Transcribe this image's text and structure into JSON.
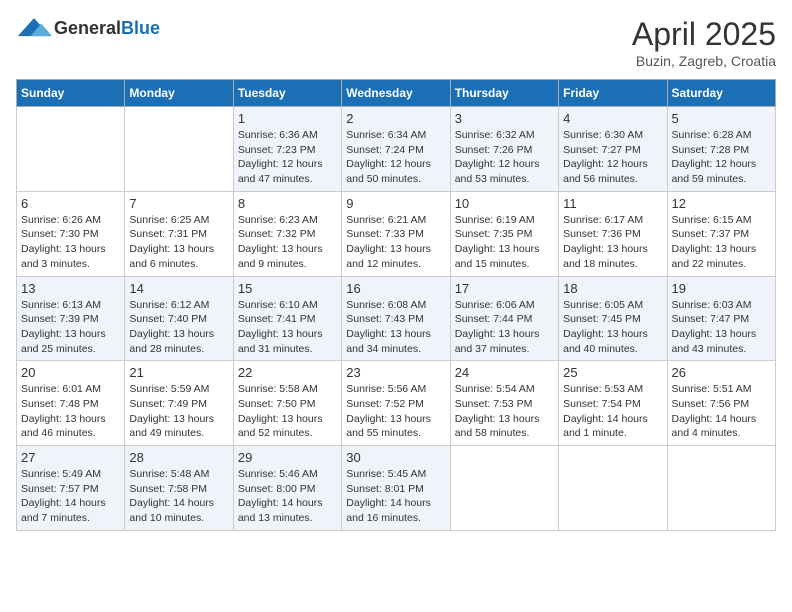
{
  "header": {
    "logo_general": "General",
    "logo_blue": "Blue",
    "month": "April 2025",
    "location": "Buzin, Zagreb, Croatia"
  },
  "weekdays": [
    "Sunday",
    "Monday",
    "Tuesday",
    "Wednesday",
    "Thursday",
    "Friday",
    "Saturday"
  ],
  "weeks": [
    [
      {
        "day": "",
        "sunrise": "",
        "sunset": "",
        "daylight": ""
      },
      {
        "day": "",
        "sunrise": "",
        "sunset": "",
        "daylight": ""
      },
      {
        "day": "1",
        "sunrise": "Sunrise: 6:36 AM",
        "sunset": "Sunset: 7:23 PM",
        "daylight": "Daylight: 12 hours and 47 minutes."
      },
      {
        "day": "2",
        "sunrise": "Sunrise: 6:34 AM",
        "sunset": "Sunset: 7:24 PM",
        "daylight": "Daylight: 12 hours and 50 minutes."
      },
      {
        "day": "3",
        "sunrise": "Sunrise: 6:32 AM",
        "sunset": "Sunset: 7:26 PM",
        "daylight": "Daylight: 12 hours and 53 minutes."
      },
      {
        "day": "4",
        "sunrise": "Sunrise: 6:30 AM",
        "sunset": "Sunset: 7:27 PM",
        "daylight": "Daylight: 12 hours and 56 minutes."
      },
      {
        "day": "5",
        "sunrise": "Sunrise: 6:28 AM",
        "sunset": "Sunset: 7:28 PM",
        "daylight": "Daylight: 12 hours and 59 minutes."
      }
    ],
    [
      {
        "day": "6",
        "sunrise": "Sunrise: 6:26 AM",
        "sunset": "Sunset: 7:30 PM",
        "daylight": "Daylight: 13 hours and 3 minutes."
      },
      {
        "day": "7",
        "sunrise": "Sunrise: 6:25 AM",
        "sunset": "Sunset: 7:31 PM",
        "daylight": "Daylight: 13 hours and 6 minutes."
      },
      {
        "day": "8",
        "sunrise": "Sunrise: 6:23 AM",
        "sunset": "Sunset: 7:32 PM",
        "daylight": "Daylight: 13 hours and 9 minutes."
      },
      {
        "day": "9",
        "sunrise": "Sunrise: 6:21 AM",
        "sunset": "Sunset: 7:33 PM",
        "daylight": "Daylight: 13 hours and 12 minutes."
      },
      {
        "day": "10",
        "sunrise": "Sunrise: 6:19 AM",
        "sunset": "Sunset: 7:35 PM",
        "daylight": "Daylight: 13 hours and 15 minutes."
      },
      {
        "day": "11",
        "sunrise": "Sunrise: 6:17 AM",
        "sunset": "Sunset: 7:36 PM",
        "daylight": "Daylight: 13 hours and 18 minutes."
      },
      {
        "day": "12",
        "sunrise": "Sunrise: 6:15 AM",
        "sunset": "Sunset: 7:37 PM",
        "daylight": "Daylight: 13 hours and 22 minutes."
      }
    ],
    [
      {
        "day": "13",
        "sunrise": "Sunrise: 6:13 AM",
        "sunset": "Sunset: 7:39 PM",
        "daylight": "Daylight: 13 hours and 25 minutes."
      },
      {
        "day": "14",
        "sunrise": "Sunrise: 6:12 AM",
        "sunset": "Sunset: 7:40 PM",
        "daylight": "Daylight: 13 hours and 28 minutes."
      },
      {
        "day": "15",
        "sunrise": "Sunrise: 6:10 AM",
        "sunset": "Sunset: 7:41 PM",
        "daylight": "Daylight: 13 hours and 31 minutes."
      },
      {
        "day": "16",
        "sunrise": "Sunrise: 6:08 AM",
        "sunset": "Sunset: 7:43 PM",
        "daylight": "Daylight: 13 hours and 34 minutes."
      },
      {
        "day": "17",
        "sunrise": "Sunrise: 6:06 AM",
        "sunset": "Sunset: 7:44 PM",
        "daylight": "Daylight: 13 hours and 37 minutes."
      },
      {
        "day": "18",
        "sunrise": "Sunrise: 6:05 AM",
        "sunset": "Sunset: 7:45 PM",
        "daylight": "Daylight: 13 hours and 40 minutes."
      },
      {
        "day": "19",
        "sunrise": "Sunrise: 6:03 AM",
        "sunset": "Sunset: 7:47 PM",
        "daylight": "Daylight: 13 hours and 43 minutes."
      }
    ],
    [
      {
        "day": "20",
        "sunrise": "Sunrise: 6:01 AM",
        "sunset": "Sunset: 7:48 PM",
        "daylight": "Daylight: 13 hours and 46 minutes."
      },
      {
        "day": "21",
        "sunrise": "Sunrise: 5:59 AM",
        "sunset": "Sunset: 7:49 PM",
        "daylight": "Daylight: 13 hours and 49 minutes."
      },
      {
        "day": "22",
        "sunrise": "Sunrise: 5:58 AM",
        "sunset": "Sunset: 7:50 PM",
        "daylight": "Daylight: 13 hours and 52 minutes."
      },
      {
        "day": "23",
        "sunrise": "Sunrise: 5:56 AM",
        "sunset": "Sunset: 7:52 PM",
        "daylight": "Daylight: 13 hours and 55 minutes."
      },
      {
        "day": "24",
        "sunrise": "Sunrise: 5:54 AM",
        "sunset": "Sunset: 7:53 PM",
        "daylight": "Daylight: 13 hours and 58 minutes."
      },
      {
        "day": "25",
        "sunrise": "Sunrise: 5:53 AM",
        "sunset": "Sunset: 7:54 PM",
        "daylight": "Daylight: 14 hours and 1 minute."
      },
      {
        "day": "26",
        "sunrise": "Sunrise: 5:51 AM",
        "sunset": "Sunset: 7:56 PM",
        "daylight": "Daylight: 14 hours and 4 minutes."
      }
    ],
    [
      {
        "day": "27",
        "sunrise": "Sunrise: 5:49 AM",
        "sunset": "Sunset: 7:57 PM",
        "daylight": "Daylight: 14 hours and 7 minutes."
      },
      {
        "day": "28",
        "sunrise": "Sunrise: 5:48 AM",
        "sunset": "Sunset: 7:58 PM",
        "daylight": "Daylight: 14 hours and 10 minutes."
      },
      {
        "day": "29",
        "sunrise": "Sunrise: 5:46 AM",
        "sunset": "Sunset: 8:00 PM",
        "daylight": "Daylight: 14 hours and 13 minutes."
      },
      {
        "day": "30",
        "sunrise": "Sunrise: 5:45 AM",
        "sunset": "Sunset: 8:01 PM",
        "daylight": "Daylight: 14 hours and 16 minutes."
      },
      {
        "day": "",
        "sunrise": "",
        "sunset": "",
        "daylight": ""
      },
      {
        "day": "",
        "sunrise": "",
        "sunset": "",
        "daylight": ""
      },
      {
        "day": "",
        "sunrise": "",
        "sunset": "",
        "daylight": ""
      }
    ]
  ]
}
